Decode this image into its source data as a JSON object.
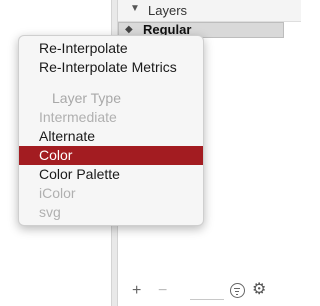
{
  "layers_panel": {
    "disclosure_glyph": "▼",
    "title": "Layers",
    "row_glyph": "◆",
    "current_layer": "Regular"
  },
  "toolbar": {
    "add_glyph": "+",
    "remove_glyph": "−",
    "gear_glyph": "⚙"
  },
  "context_menu": {
    "items": [
      {
        "label": "Re-Interpolate",
        "state": "enabled"
      },
      {
        "label": "Re-Interpolate Metrics",
        "state": "enabled"
      },
      {
        "label": "Layer Type",
        "state": "header"
      },
      {
        "label": "Intermediate",
        "state": "disabled"
      },
      {
        "label": "Alternate",
        "state": "enabled"
      },
      {
        "label": "Color",
        "state": "selected"
      },
      {
        "label": "Color Palette",
        "state": "enabled"
      },
      {
        "label": "iColor",
        "state": "disabled"
      },
      {
        "label": "svg",
        "state": "disabled"
      }
    ],
    "highlight_color": "#a31c21"
  }
}
